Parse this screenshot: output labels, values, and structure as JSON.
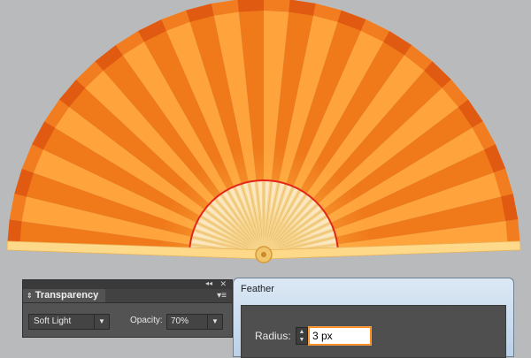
{
  "colors": {
    "canvas_background": "#b9babc",
    "fan_orange_dark": "#f07a1a",
    "fan_orange_light": "#ffa43d",
    "fan_stick": "#f6d38b",
    "fan_red_arc": "#e3261b",
    "panel_background": "#535353",
    "focus_orange": "#ff8a1a"
  },
  "transparency_panel": {
    "title": "Transparency",
    "tab_icon": "up-down-arrows-icon",
    "collapse_icon": "double-chevron-left-icon",
    "close_icon": "close-icon",
    "menu_icon": "panel-menu-icon",
    "blend_mode": "Soft Light",
    "opacity_label": "Opacity:",
    "opacity_value": "70%"
  },
  "feather_dialog": {
    "title": "Feather",
    "radius_label": "Radius:",
    "radius_value": "3 px"
  }
}
